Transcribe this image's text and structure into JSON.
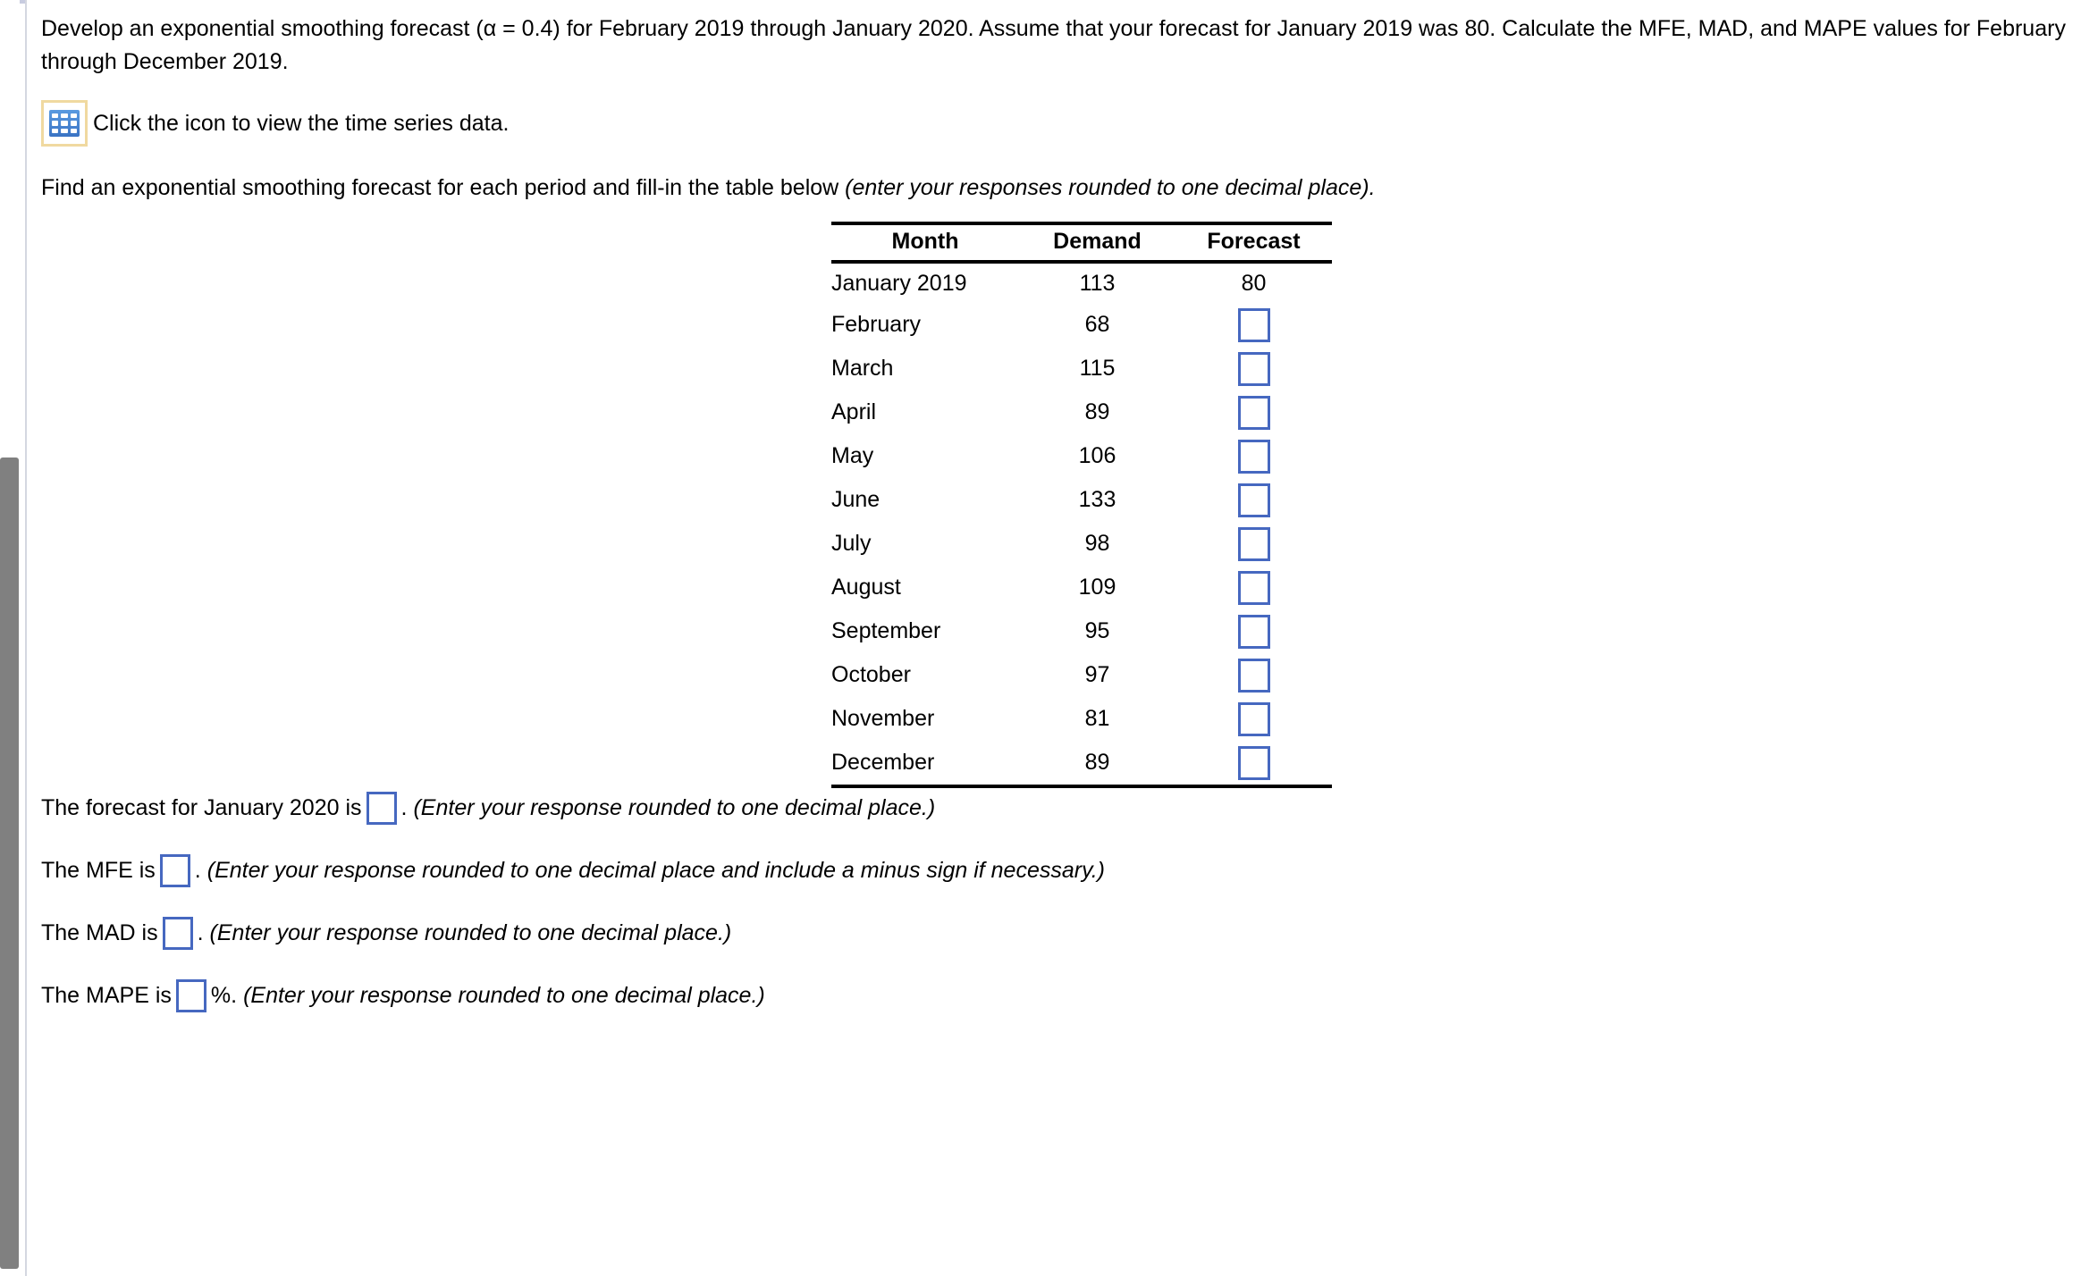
{
  "problem": {
    "statement": "Develop an exponential smoothing forecast (α = 0.4) for February 2019 through January 2020. Assume that your forecast  for January 2019 was 80. Calculate the MFE, MAD, and MAPE values for February through December 2019.",
    "icon_line": "Click the icon to view the time series data.",
    "icon_name": "spreadsheet-grid-icon",
    "instruction_plain": "Find an exponential smoothing forecast for each period and fill-in the table below ",
    "instruction_italic": "(enter your responses rounded to one decimal place)."
  },
  "table": {
    "headers": [
      "Month",
      "Demand",
      "Forecast"
    ],
    "rows": [
      {
        "month": "January 2019",
        "demand": "113",
        "forecast": "80",
        "forecast_is_input": false
      },
      {
        "month": "February",
        "demand": "68",
        "forecast": "",
        "forecast_is_input": true
      },
      {
        "month": "March",
        "demand": "115",
        "forecast": "",
        "forecast_is_input": true
      },
      {
        "month": "April",
        "demand": "89",
        "forecast": "",
        "forecast_is_input": true
      },
      {
        "month": "May",
        "demand": "106",
        "forecast": "",
        "forecast_is_input": true
      },
      {
        "month": "June",
        "demand": "133",
        "forecast": "",
        "forecast_is_input": true
      },
      {
        "month": "July",
        "demand": "98",
        "forecast": "",
        "forecast_is_input": true
      },
      {
        "month": "August",
        "demand": "109",
        "forecast": "",
        "forecast_is_input": true
      },
      {
        "month": "September",
        "demand": "95",
        "forecast": "",
        "forecast_is_input": true
      },
      {
        "month": "October",
        "demand": "97",
        "forecast": "",
        "forecast_is_input": true
      },
      {
        "month": "November",
        "demand": "81",
        "forecast": "",
        "forecast_is_input": true
      },
      {
        "month": "December",
        "demand": "89",
        "forecast": "",
        "forecast_is_input": true
      }
    ]
  },
  "answers": [
    {
      "prefix": "The forecast for January 2020 is",
      "value": "",
      "suffix": ".",
      "hint": "(Enter your response rounded to one decimal place.)"
    },
    {
      "prefix": "The MFE is",
      "value": "",
      "suffix": ".",
      "hint": "(Enter your response rounded to one decimal place and include a minus sign if necessary.)"
    },
    {
      "prefix": "The MAD is",
      "value": "",
      "suffix": ".",
      "hint": "(Enter your response rounded to one decimal place.)"
    },
    {
      "prefix": "The MAPE is",
      "value": "",
      "suffix": "%.",
      "hint": "(Enter your response rounded to one decimal place.)"
    }
  ],
  "colors": {
    "input_border": "#4668c0",
    "icon_blue": "#3f7fd0",
    "icon_frame": "#f0d9a0",
    "scrollbar_thumb": "#808080"
  }
}
